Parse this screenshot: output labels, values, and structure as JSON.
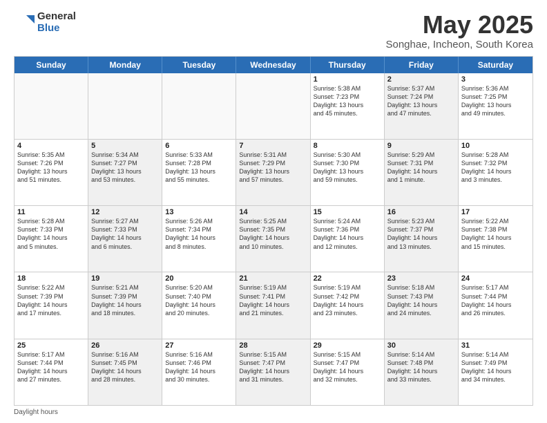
{
  "logo": {
    "general": "General",
    "blue": "Blue"
  },
  "title": "May 2025",
  "subtitle": "Songhae, Incheon, South Korea",
  "header_days": [
    "Sunday",
    "Monday",
    "Tuesday",
    "Wednesday",
    "Thursday",
    "Friday",
    "Saturday"
  ],
  "weeks": [
    [
      {
        "day": "",
        "text": "",
        "shaded": false,
        "empty": true
      },
      {
        "day": "",
        "text": "",
        "shaded": false,
        "empty": true
      },
      {
        "day": "",
        "text": "",
        "shaded": false,
        "empty": true
      },
      {
        "day": "",
        "text": "",
        "shaded": false,
        "empty": true
      },
      {
        "day": "1",
        "text": "Sunrise: 5:38 AM\nSunset: 7:23 PM\nDaylight: 13 hours\nand 45 minutes.",
        "shaded": false,
        "empty": false
      },
      {
        "day": "2",
        "text": "Sunrise: 5:37 AM\nSunset: 7:24 PM\nDaylight: 13 hours\nand 47 minutes.",
        "shaded": true,
        "empty": false
      },
      {
        "day": "3",
        "text": "Sunrise: 5:36 AM\nSunset: 7:25 PM\nDaylight: 13 hours\nand 49 minutes.",
        "shaded": false,
        "empty": false
      }
    ],
    [
      {
        "day": "4",
        "text": "Sunrise: 5:35 AM\nSunset: 7:26 PM\nDaylight: 13 hours\nand 51 minutes.",
        "shaded": false,
        "empty": false
      },
      {
        "day": "5",
        "text": "Sunrise: 5:34 AM\nSunset: 7:27 PM\nDaylight: 13 hours\nand 53 minutes.",
        "shaded": true,
        "empty": false
      },
      {
        "day": "6",
        "text": "Sunrise: 5:33 AM\nSunset: 7:28 PM\nDaylight: 13 hours\nand 55 minutes.",
        "shaded": false,
        "empty": false
      },
      {
        "day": "7",
        "text": "Sunrise: 5:31 AM\nSunset: 7:29 PM\nDaylight: 13 hours\nand 57 minutes.",
        "shaded": true,
        "empty": false
      },
      {
        "day": "8",
        "text": "Sunrise: 5:30 AM\nSunset: 7:30 PM\nDaylight: 13 hours\nand 59 minutes.",
        "shaded": false,
        "empty": false
      },
      {
        "day": "9",
        "text": "Sunrise: 5:29 AM\nSunset: 7:31 PM\nDaylight: 14 hours\nand 1 minute.",
        "shaded": true,
        "empty": false
      },
      {
        "day": "10",
        "text": "Sunrise: 5:28 AM\nSunset: 7:32 PM\nDaylight: 14 hours\nand 3 minutes.",
        "shaded": false,
        "empty": false
      }
    ],
    [
      {
        "day": "11",
        "text": "Sunrise: 5:28 AM\nSunset: 7:33 PM\nDaylight: 14 hours\nand 5 minutes.",
        "shaded": false,
        "empty": false
      },
      {
        "day": "12",
        "text": "Sunrise: 5:27 AM\nSunset: 7:33 PM\nDaylight: 14 hours\nand 6 minutes.",
        "shaded": true,
        "empty": false
      },
      {
        "day": "13",
        "text": "Sunrise: 5:26 AM\nSunset: 7:34 PM\nDaylight: 14 hours\nand 8 minutes.",
        "shaded": false,
        "empty": false
      },
      {
        "day": "14",
        "text": "Sunrise: 5:25 AM\nSunset: 7:35 PM\nDaylight: 14 hours\nand 10 minutes.",
        "shaded": true,
        "empty": false
      },
      {
        "day": "15",
        "text": "Sunrise: 5:24 AM\nSunset: 7:36 PM\nDaylight: 14 hours\nand 12 minutes.",
        "shaded": false,
        "empty": false
      },
      {
        "day": "16",
        "text": "Sunrise: 5:23 AM\nSunset: 7:37 PM\nDaylight: 14 hours\nand 13 minutes.",
        "shaded": true,
        "empty": false
      },
      {
        "day": "17",
        "text": "Sunrise: 5:22 AM\nSunset: 7:38 PM\nDaylight: 14 hours\nand 15 minutes.",
        "shaded": false,
        "empty": false
      }
    ],
    [
      {
        "day": "18",
        "text": "Sunrise: 5:22 AM\nSunset: 7:39 PM\nDaylight: 14 hours\nand 17 minutes.",
        "shaded": false,
        "empty": false
      },
      {
        "day": "19",
        "text": "Sunrise: 5:21 AM\nSunset: 7:39 PM\nDaylight: 14 hours\nand 18 minutes.",
        "shaded": true,
        "empty": false
      },
      {
        "day": "20",
        "text": "Sunrise: 5:20 AM\nSunset: 7:40 PM\nDaylight: 14 hours\nand 20 minutes.",
        "shaded": false,
        "empty": false
      },
      {
        "day": "21",
        "text": "Sunrise: 5:19 AM\nSunset: 7:41 PM\nDaylight: 14 hours\nand 21 minutes.",
        "shaded": true,
        "empty": false
      },
      {
        "day": "22",
        "text": "Sunrise: 5:19 AM\nSunset: 7:42 PM\nDaylight: 14 hours\nand 23 minutes.",
        "shaded": false,
        "empty": false
      },
      {
        "day": "23",
        "text": "Sunrise: 5:18 AM\nSunset: 7:43 PM\nDaylight: 14 hours\nand 24 minutes.",
        "shaded": true,
        "empty": false
      },
      {
        "day": "24",
        "text": "Sunrise: 5:17 AM\nSunset: 7:44 PM\nDaylight: 14 hours\nand 26 minutes.",
        "shaded": false,
        "empty": false
      }
    ],
    [
      {
        "day": "25",
        "text": "Sunrise: 5:17 AM\nSunset: 7:44 PM\nDaylight: 14 hours\nand 27 minutes.",
        "shaded": false,
        "empty": false
      },
      {
        "day": "26",
        "text": "Sunrise: 5:16 AM\nSunset: 7:45 PM\nDaylight: 14 hours\nand 28 minutes.",
        "shaded": true,
        "empty": false
      },
      {
        "day": "27",
        "text": "Sunrise: 5:16 AM\nSunset: 7:46 PM\nDaylight: 14 hours\nand 30 minutes.",
        "shaded": false,
        "empty": false
      },
      {
        "day": "28",
        "text": "Sunrise: 5:15 AM\nSunset: 7:47 PM\nDaylight: 14 hours\nand 31 minutes.",
        "shaded": true,
        "empty": false
      },
      {
        "day": "29",
        "text": "Sunrise: 5:15 AM\nSunset: 7:47 PM\nDaylight: 14 hours\nand 32 minutes.",
        "shaded": false,
        "empty": false
      },
      {
        "day": "30",
        "text": "Sunrise: 5:14 AM\nSunset: 7:48 PM\nDaylight: 14 hours\nand 33 minutes.",
        "shaded": true,
        "empty": false
      },
      {
        "day": "31",
        "text": "Sunrise: 5:14 AM\nSunset: 7:49 PM\nDaylight: 14 hours\nand 34 minutes.",
        "shaded": false,
        "empty": false
      }
    ]
  ],
  "footer": {
    "daylight_label": "Daylight hours"
  }
}
